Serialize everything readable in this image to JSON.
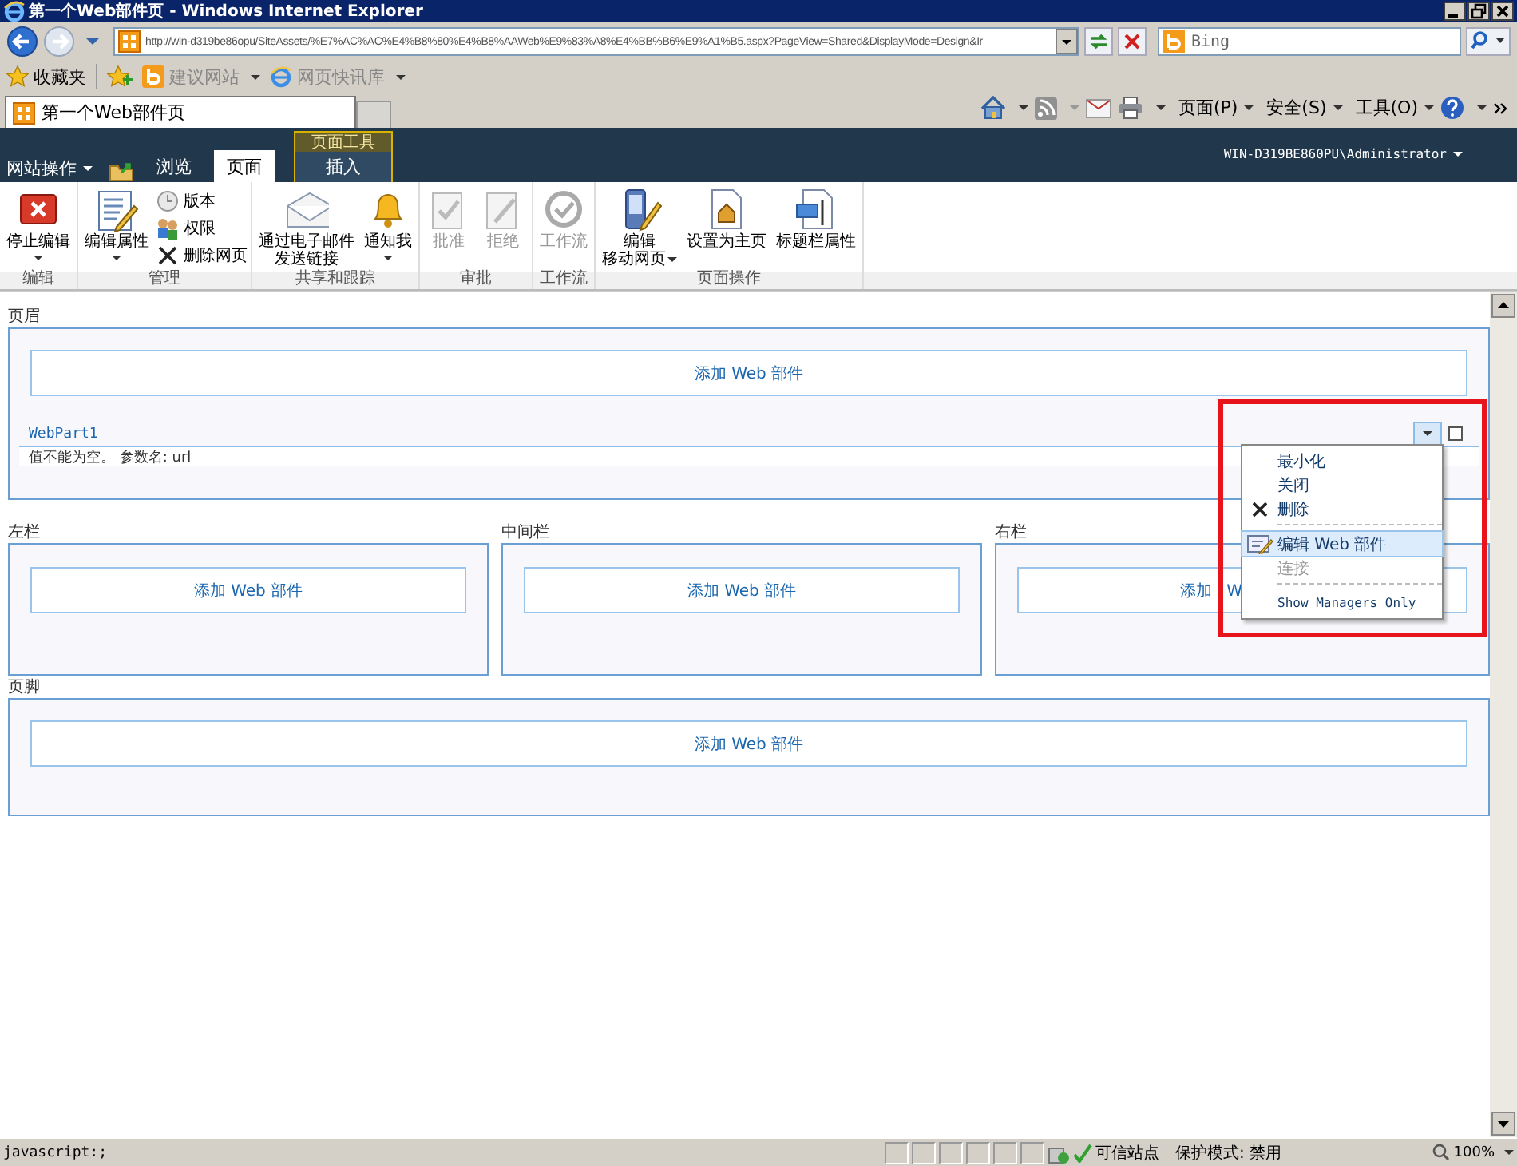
{
  "window": {
    "title": "第一个Web部件页 - Windows Internet Explorer"
  },
  "address_bar": {
    "url": "http://win-d319be86opu/SiteAssets/%E7%AC%AC%E4%B8%80%E4%B8%AAWeb%E9%83%A8%E4%BB%B6%E9%A1%B5.aspx?PageView=Shared&DisplayMode=Design&Ir"
  },
  "search": {
    "placeholder": "Bing"
  },
  "favorites_bar": {
    "label": "收藏夹",
    "items": [
      "建议网站",
      "网页快讯库"
    ]
  },
  "tabs": [
    {
      "label": "第一个Web部件页",
      "selected": true
    }
  ],
  "command_bar": [
    "页面(P)",
    "安全(S)",
    "工具(O)"
  ],
  "site_header": {
    "site_actions": "网站操作",
    "tabs": [
      {
        "label": "浏览",
        "selected": false
      },
      {
        "label": "页面",
        "selected": true
      }
    ],
    "context_group": "页面工具",
    "context_tabs": [
      {
        "label": "插入",
        "selected": false
      }
    ],
    "user": "WIN-D319BE860PU\\Administrator"
  },
  "ribbon": [
    {
      "label": "编辑",
      "buttons": [
        {
          "lines": [
            "停止编辑"
          ],
          "kind": "large",
          "dropdown": true,
          "disabled": false
        }
      ]
    },
    {
      "label": "管理",
      "buttons": [
        {
          "lines": [
            "编辑属性"
          ],
          "kind": "large",
          "dropdown": true,
          "disabled": false
        },
        {
          "lines": [
            "版本"
          ],
          "kind": "small",
          "dropdown": false,
          "disabled": false
        },
        {
          "lines": [
            "权限"
          ],
          "kind": "small",
          "dropdown": false,
          "disabled": false
        },
        {
          "lines": [
            "删除网页"
          ],
          "kind": "small",
          "dropdown": false,
          "disabled": false
        }
      ]
    },
    {
      "label": "共享和跟踪",
      "buttons": [
        {
          "lines": [
            "通过电子邮件",
            "发送链接"
          ],
          "kind": "large",
          "dropdown": false,
          "disabled": false
        },
        {
          "lines": [
            "通知我"
          ],
          "kind": "large",
          "dropdown": true,
          "disabled": false
        }
      ]
    },
    {
      "label": "审批",
      "buttons": [
        {
          "lines": [
            "批准"
          ],
          "kind": "large",
          "dropdown": false,
          "disabled": true
        },
        {
          "lines": [
            "拒绝"
          ],
          "kind": "large",
          "dropdown": false,
          "disabled": true
        }
      ]
    },
    {
      "label": "工作流",
      "buttons": [
        {
          "lines": [
            "工作流"
          ],
          "kind": "large",
          "dropdown": false,
          "disabled": true
        }
      ]
    },
    {
      "label": "页面操作",
      "buttons": [
        {
          "lines": [
            "编辑",
            "移动网页"
          ],
          "kind": "large",
          "dropdown": true,
          "disabled": false
        },
        {
          "lines": [
            "设置为主页"
          ],
          "kind": "large",
          "dropdown": false,
          "disabled": false
        },
        {
          "lines": [
            "标题栏属性"
          ],
          "kind": "large",
          "dropdown": false,
          "disabled": false
        }
      ]
    }
  ],
  "header_zone": {
    "label": "页眉",
    "add_button": "添加 Web 部件",
    "web_part": {
      "title": "WebPart1",
      "message": "值不能为空。 参数名: url",
      "checked": false
    }
  },
  "columns": [
    {
      "label": "左栏",
      "add_button": "添加 Web 部件"
    },
    {
      "label": "中间栏",
      "add_button": "添加 Web 部件"
    },
    {
      "label": "右栏",
      "add_button": "添加 W"
    }
  ],
  "footer_zone": {
    "label": "页脚",
    "add_button": "添加 Web 部件"
  },
  "web_part_menu": [
    {
      "kind": "item",
      "label": "最小化",
      "selected": false,
      "disabled": false
    },
    {
      "kind": "item",
      "label": "关闭",
      "selected": false,
      "disabled": false
    },
    {
      "kind": "item",
      "label": "删除",
      "selected": false,
      "disabled": false
    },
    {
      "kind": "separator"
    },
    {
      "kind": "item",
      "label": "编辑 Web 部件",
      "selected": true,
      "disabled": false
    },
    {
      "kind": "item",
      "label": "连接",
      "selected": false,
      "disabled": true
    },
    {
      "kind": "separator"
    },
    {
      "kind": "item",
      "label": "Show Managers Only",
      "selected": false,
      "disabled": false
    }
  ],
  "status_bar": {
    "text": "javascript:;",
    "zone": "可信站点",
    "protected_mode": "保护模式: 禁用",
    "zoom": "100%"
  }
}
